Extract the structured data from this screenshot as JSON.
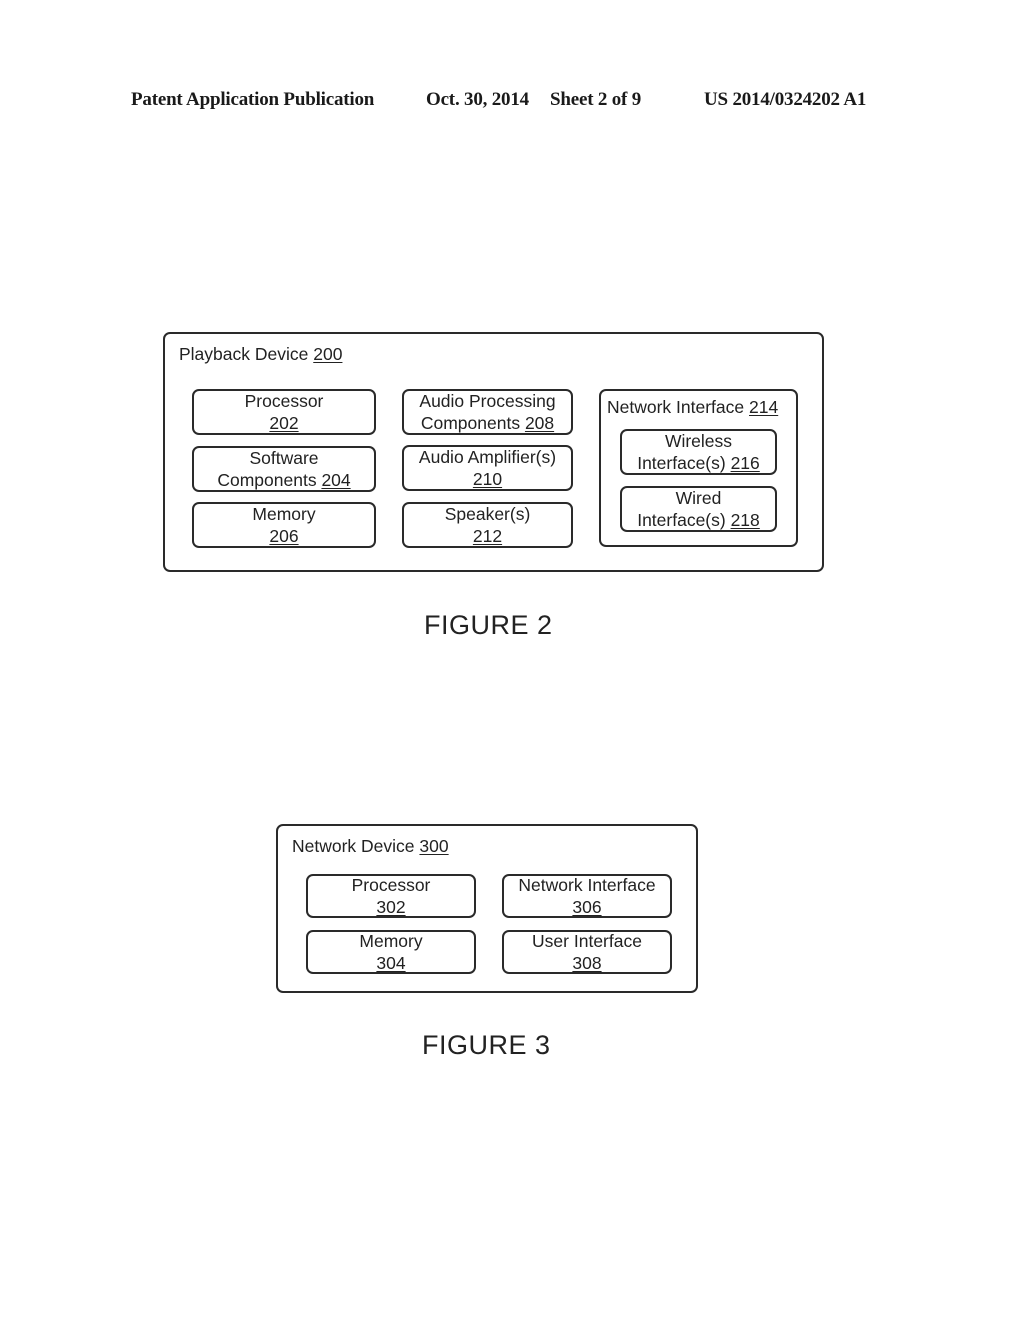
{
  "header": {
    "publication": "Patent Application Publication",
    "date": "Oct. 30, 2014",
    "sheet": "Sheet 2 of 9",
    "number": "US 2014/0324202 A1"
  },
  "figure2": {
    "container": {
      "label": "Playback Device",
      "ref": "200"
    },
    "left_column": [
      {
        "line1": "Processor",
        "line2": "",
        "ref": "202"
      },
      {
        "line1": "Software",
        "line2": "Components ",
        "ref": "204"
      },
      {
        "line1": "Memory",
        "line2": "",
        "ref": "206"
      }
    ],
    "middle_column": [
      {
        "line1": "Audio Processing",
        "line2": "Components ",
        "ref": "208"
      },
      {
        "line1": "Audio Amplifier(s)",
        "line2": "",
        "ref": "210"
      },
      {
        "line1": "Speaker(s)",
        "line2": "",
        "ref": "212"
      }
    ],
    "network_interface": {
      "label": "Network Interface ",
      "ref": "214",
      "children": [
        {
          "line1": "Wireless",
          "line2": "Interface(s) ",
          "ref": "216"
        },
        {
          "line1": "Wired",
          "line2": "Interface(s) ",
          "ref": "218"
        }
      ]
    },
    "caption": "FIGURE 2"
  },
  "figure3": {
    "container": {
      "label": "Network Device",
      "ref": "300"
    },
    "blocks": [
      {
        "line1": "Processor",
        "ref": "302"
      },
      {
        "line1": "Network Interface",
        "ref": "306"
      },
      {
        "line1": "Memory",
        "ref": "304"
      },
      {
        "line1": "User Interface",
        "ref": "308"
      }
    ],
    "caption": "FIGURE 3"
  }
}
